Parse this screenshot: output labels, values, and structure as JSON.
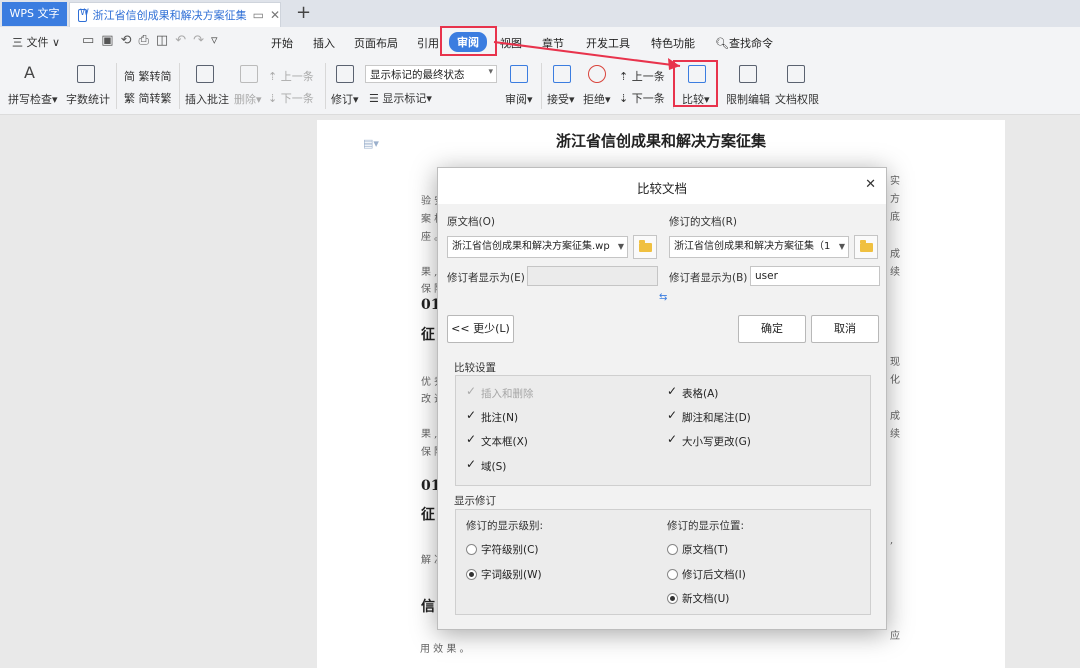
{
  "tabbar": {
    "app_tab": "WPS 文字",
    "doc_tab": "浙江省信创成果和解决方案征集",
    "add_tab": "+"
  },
  "menubar": {
    "file": "三 文件 ∨",
    "tabs": [
      "开始",
      "插入",
      "页面布局",
      "引用",
      "审阅",
      "视图",
      "章节",
      "开发工具",
      "特色功能"
    ],
    "active_tab": "审阅",
    "search": "查找命令"
  },
  "ribbon": {
    "spell_check": "拼写检查",
    "word_count": "字数统计",
    "trad_to_simp": "繁转简",
    "simp_to_trad": "简转繁",
    "insert_comment": "插入批注",
    "delete": "删除",
    "prev_comment": "上一条",
    "next_comment": "下一条",
    "track_changes": "修订",
    "display_state": "显示标记的最终状态",
    "show_markup": "显示标记",
    "review": "审阅",
    "accept": "接受",
    "reject": "拒绝",
    "prev_change": "上一条",
    "next_change": "下一条",
    "compare": "比较",
    "restrict_edit": "限制编辑",
    "doc_permission": "文档权限"
  },
  "document": {
    "heading": "浙江省信创成果和解决方案征集",
    "fragments_left": [
      "验 安",
      "案 栏",
      "座 。",
      "果 ,",
      "保 障",
      "01",
      "征",
      "优 秀",
      "改 造",
      "果 ,",
      "保 障",
      "01",
      "征",
      "解 决",
      "信"
    ],
    "fragments_right": [
      "实",
      "方",
      "底",
      "成",
      "续",
      "现",
      "化",
      "成",
      "续",
      ","
    ],
    "bottom_line_1": "应",
    "bottom_line_2": "用 效 果 。"
  },
  "dialog": {
    "title": "比较文档",
    "original_label": "原文档(O)",
    "original_value": "浙江省信创成果和解决方案征集.wp",
    "revised_label": "修订的文档(R)",
    "revised_value": "浙江省信创成果和解决方案征集（1",
    "author_label_left": "修订者显示为(E)",
    "author_value_left": "",
    "author_label_right": "修订者显示为(B)",
    "author_value_right": "user",
    "less_button": "<< 更少(L)",
    "ok_button": "确定",
    "cancel_button": "取消",
    "compare_settings_title": "比较设置",
    "options": [
      {
        "label": "插入和删除",
        "checked": true,
        "disabled": true
      },
      {
        "label": "表格(A)",
        "checked": true,
        "disabled": false
      },
      {
        "label": "批注(N)",
        "checked": true,
        "disabled": false
      },
      {
        "label": "脚注和尾注(D)",
        "checked": true,
        "disabled": false
      },
      {
        "label": "文本框(X)",
        "checked": true,
        "disabled": false
      },
      {
        "label": "大小写更改(G)",
        "checked": true,
        "disabled": false
      },
      {
        "label": "域(S)",
        "checked": true,
        "disabled": false
      }
    ],
    "show_changes_title": "显示修订",
    "level_title": "修订的显示级别:",
    "levels": [
      {
        "label": "字符级别(C)",
        "selected": false
      },
      {
        "label": "字词级别(W)",
        "selected": true
      }
    ],
    "position_title": "修订的显示位置:",
    "positions": [
      {
        "label": "原文档(T)",
        "selected": false
      },
      {
        "label": "修订后文档(I)",
        "selected": false
      },
      {
        "label": "新文档(U)",
        "selected": true
      }
    ]
  },
  "colors": {
    "accent": "#3b7de0",
    "highlight": "#e8334c"
  }
}
